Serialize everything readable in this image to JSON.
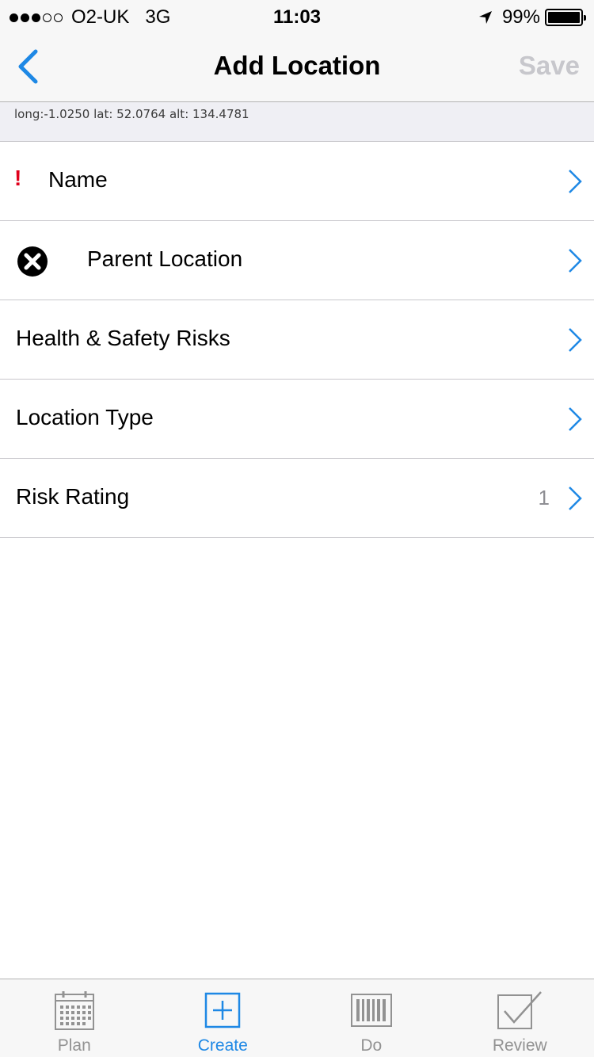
{
  "status_bar": {
    "carrier": "O2-UK",
    "network": "3G",
    "time": "11:03",
    "battery_percent": "99%",
    "battery_level": 0.99,
    "signal_bars_full": 3,
    "signal_bars_total": 5
  },
  "nav": {
    "title": "Add Location",
    "save_label": "Save",
    "back_icon": "chevron-left-icon"
  },
  "coords": "long:-1.0250 lat: 52.0764 alt: 134.4781",
  "rows": [
    {
      "label": "Name",
      "value": "",
      "required_mark": "!"
    },
    {
      "label": "Parent Location",
      "value": "",
      "icon": "clear-icon"
    },
    {
      "label": "Health & Safety Risks",
      "value": ""
    },
    {
      "label": "Location Type",
      "value": ""
    },
    {
      "label": "Risk Rating",
      "value": "1"
    }
  ],
  "tabs": [
    {
      "label": "Plan",
      "icon": "calendar-icon",
      "active": false
    },
    {
      "label": "Create",
      "icon": "plus-square-icon",
      "active": true
    },
    {
      "label": "Do",
      "icon": "barcode-icon",
      "active": false
    },
    {
      "label": "Review",
      "icon": "checkbox-icon",
      "active": false
    }
  ],
  "colors": {
    "accent": "#1e88e5",
    "required": "#e0001b",
    "disabled": "#c7c7cc",
    "tab_inactive": "#929292"
  }
}
